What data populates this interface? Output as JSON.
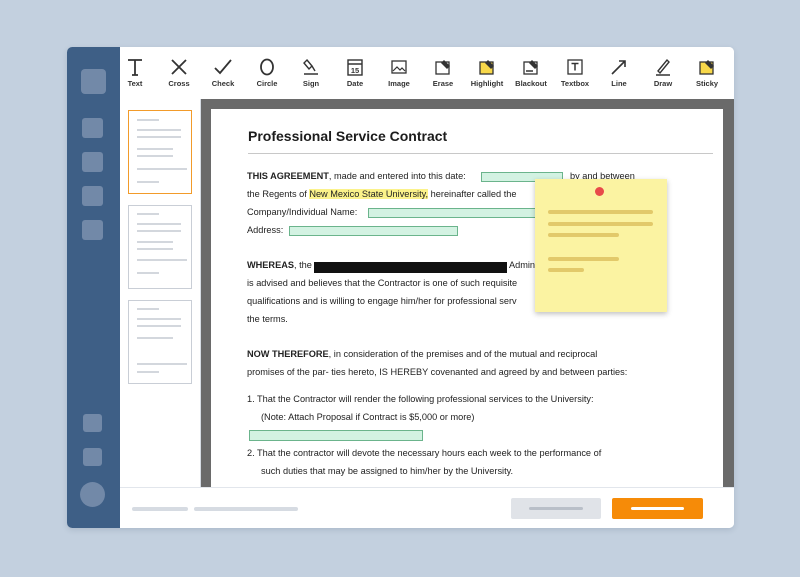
{
  "toolbar": {
    "tools": [
      {
        "label": "Text",
        "icon": "text-icon"
      },
      {
        "label": "Cross",
        "icon": "cross-icon"
      },
      {
        "label": "Check",
        "icon": "check-icon"
      },
      {
        "label": "Circle",
        "icon": "circle-icon"
      },
      {
        "label": "Sign",
        "icon": "sign-icon"
      },
      {
        "label": "Date",
        "icon": "date-icon",
        "day": "15"
      },
      {
        "label": "Image",
        "icon": "image-icon"
      },
      {
        "label": "Erase",
        "icon": "erase-icon"
      },
      {
        "label": "Highlight",
        "icon": "highlight-icon"
      },
      {
        "label": "Blackout",
        "icon": "blackout-icon"
      },
      {
        "label": "Textbox",
        "icon": "textbox-icon"
      },
      {
        "label": "Line",
        "icon": "line-icon"
      },
      {
        "label": "Draw",
        "icon": "draw-icon"
      },
      {
        "label": "Sticky",
        "icon": "sticky-icon"
      }
    ]
  },
  "document": {
    "title": "Professional Service Contract",
    "p1": {
      "bold": "THIS AGREEMENT",
      "text_a": ", made and entered into this date:",
      "text_b": "by and between",
      "line2_pre": "the Regents of ",
      "line2_highlight": "New Mexico State University,",
      "line2_post": " hereinafter called the",
      "line3": "Company/Individual Name:",
      "line4": "Address:"
    },
    "p2": {
      "bold": "WHEREAS",
      "text_a": ", the",
      "text_b": "Admin",
      "line2": "is advised and believes that the Contractor is one of such requisite",
      "line3": "qualifications and is willing to engage him/her for professional serv",
      "line4": "the terms."
    },
    "p3": {
      "bold": "NOW THEREFORE",
      "text": ", in consideration of the premises and of the mutual and reciprocal",
      "line2": "promises of the par- ties hereto, IS HEREBY covenanted and agreed by and between parties:"
    },
    "item1": {
      "text": "1. That the Contractor will render the following professional services to the University:",
      "note": "(Note: Attach Proposal if Contract is $5,000 or more)"
    },
    "item2": {
      "text": "2. That the contractor will devote the necessary hours each week to the performance of",
      "line2": "such duties that may be assigned to him/her by the University."
    }
  },
  "colors": {
    "sidebar": "#3e5f86",
    "accent": "#f68b08",
    "field": "#d3f2e2",
    "highlight": "#fbf28a",
    "sticky": "#fbf3a2"
  }
}
